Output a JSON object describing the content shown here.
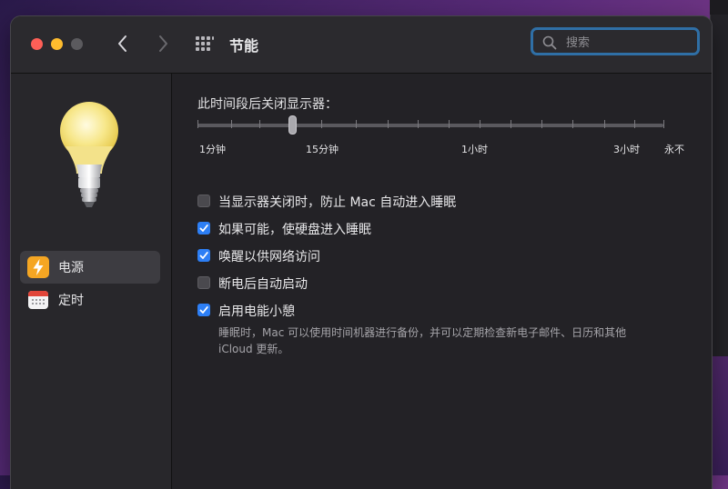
{
  "window": {
    "title": "节能"
  },
  "search": {
    "placeholder": "搜索",
    "value": ""
  },
  "sidebar": {
    "items": [
      {
        "label": "电源",
        "icon": "bolt-icon",
        "selected": true
      },
      {
        "label": "定时",
        "icon": "calendar-icon",
        "selected": false
      }
    ]
  },
  "display_sleep": {
    "title": "此时间段后关闭显示器：",
    "labels": [
      "1分钟",
      "15分钟",
      "1小时",
      "3小时",
      "永不"
    ],
    "value": "15分钟"
  },
  "options": [
    {
      "label": "当显示器关闭时，防止 Mac 自动进入睡眠",
      "checked": false
    },
    {
      "label": "如果可能，使硬盘进入睡眠",
      "checked": true
    },
    {
      "label": "唤醒以供网络访问",
      "checked": true
    },
    {
      "label": "断电后自动启动",
      "checked": false
    },
    {
      "label": "启用电能小憩",
      "checked": true
    }
  ],
  "power_nap_note": {
    "line1": "睡眠时，Mac 可以使用时间机器进行备份，并可以定期检查新电子邮件、日历和其他",
    "line2": "iCloud 更新。"
  },
  "colors": {
    "accent": "#2d7ff5",
    "search_focus": "#2f6fa6",
    "bolt_bg": "#f5a623"
  }
}
